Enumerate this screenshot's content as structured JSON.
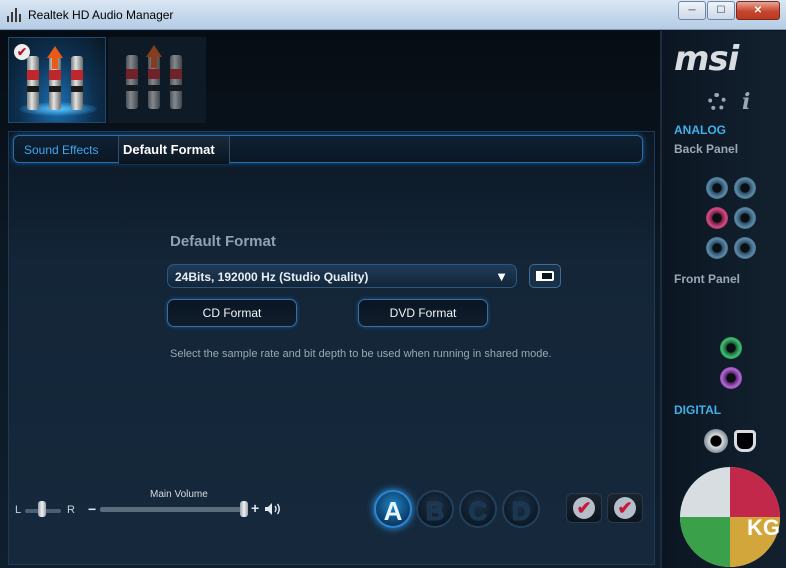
{
  "window": {
    "title": "Realtek HD Audio Manager",
    "buttons": {
      "minimize": "─",
      "maximize": "☐",
      "close": "✕"
    }
  },
  "devices": [
    {
      "name": "output-device",
      "active": true,
      "badge": "✔"
    },
    {
      "name": "input-device",
      "active": false
    }
  ],
  "tabs": {
    "sound_effects": "Sound Effects",
    "default_format": "Default Format"
  },
  "default_format": {
    "section_title": "Default Format",
    "selected": "24Bits, 192000 Hz (Studio Quality)",
    "caret": "▼",
    "cd_button": "CD Format",
    "dvd_button": "DVD Format",
    "hint": "Select the sample rate and bit depth to be used when running in shared mode."
  },
  "bottom": {
    "balance_left": "L",
    "balance_right": "R",
    "main_volume_label": "Main Volume",
    "volume_minus": "−",
    "volume_plus": "+",
    "profiles": [
      "A",
      "B",
      "C",
      "D"
    ],
    "active_profile": "A",
    "check": "✔"
  },
  "right_panel": {
    "brand": "msi",
    "info": "i",
    "analog": "ANALOG",
    "back_panel": "Back Panel",
    "front_panel": "Front Panel",
    "digital": "DIGITAL",
    "watermark": "KG"
  },
  "colors": {
    "accent": "#3fb1e8",
    "active_tab_bg": "#0a1420",
    "close_button": "#c7452d"
  }
}
